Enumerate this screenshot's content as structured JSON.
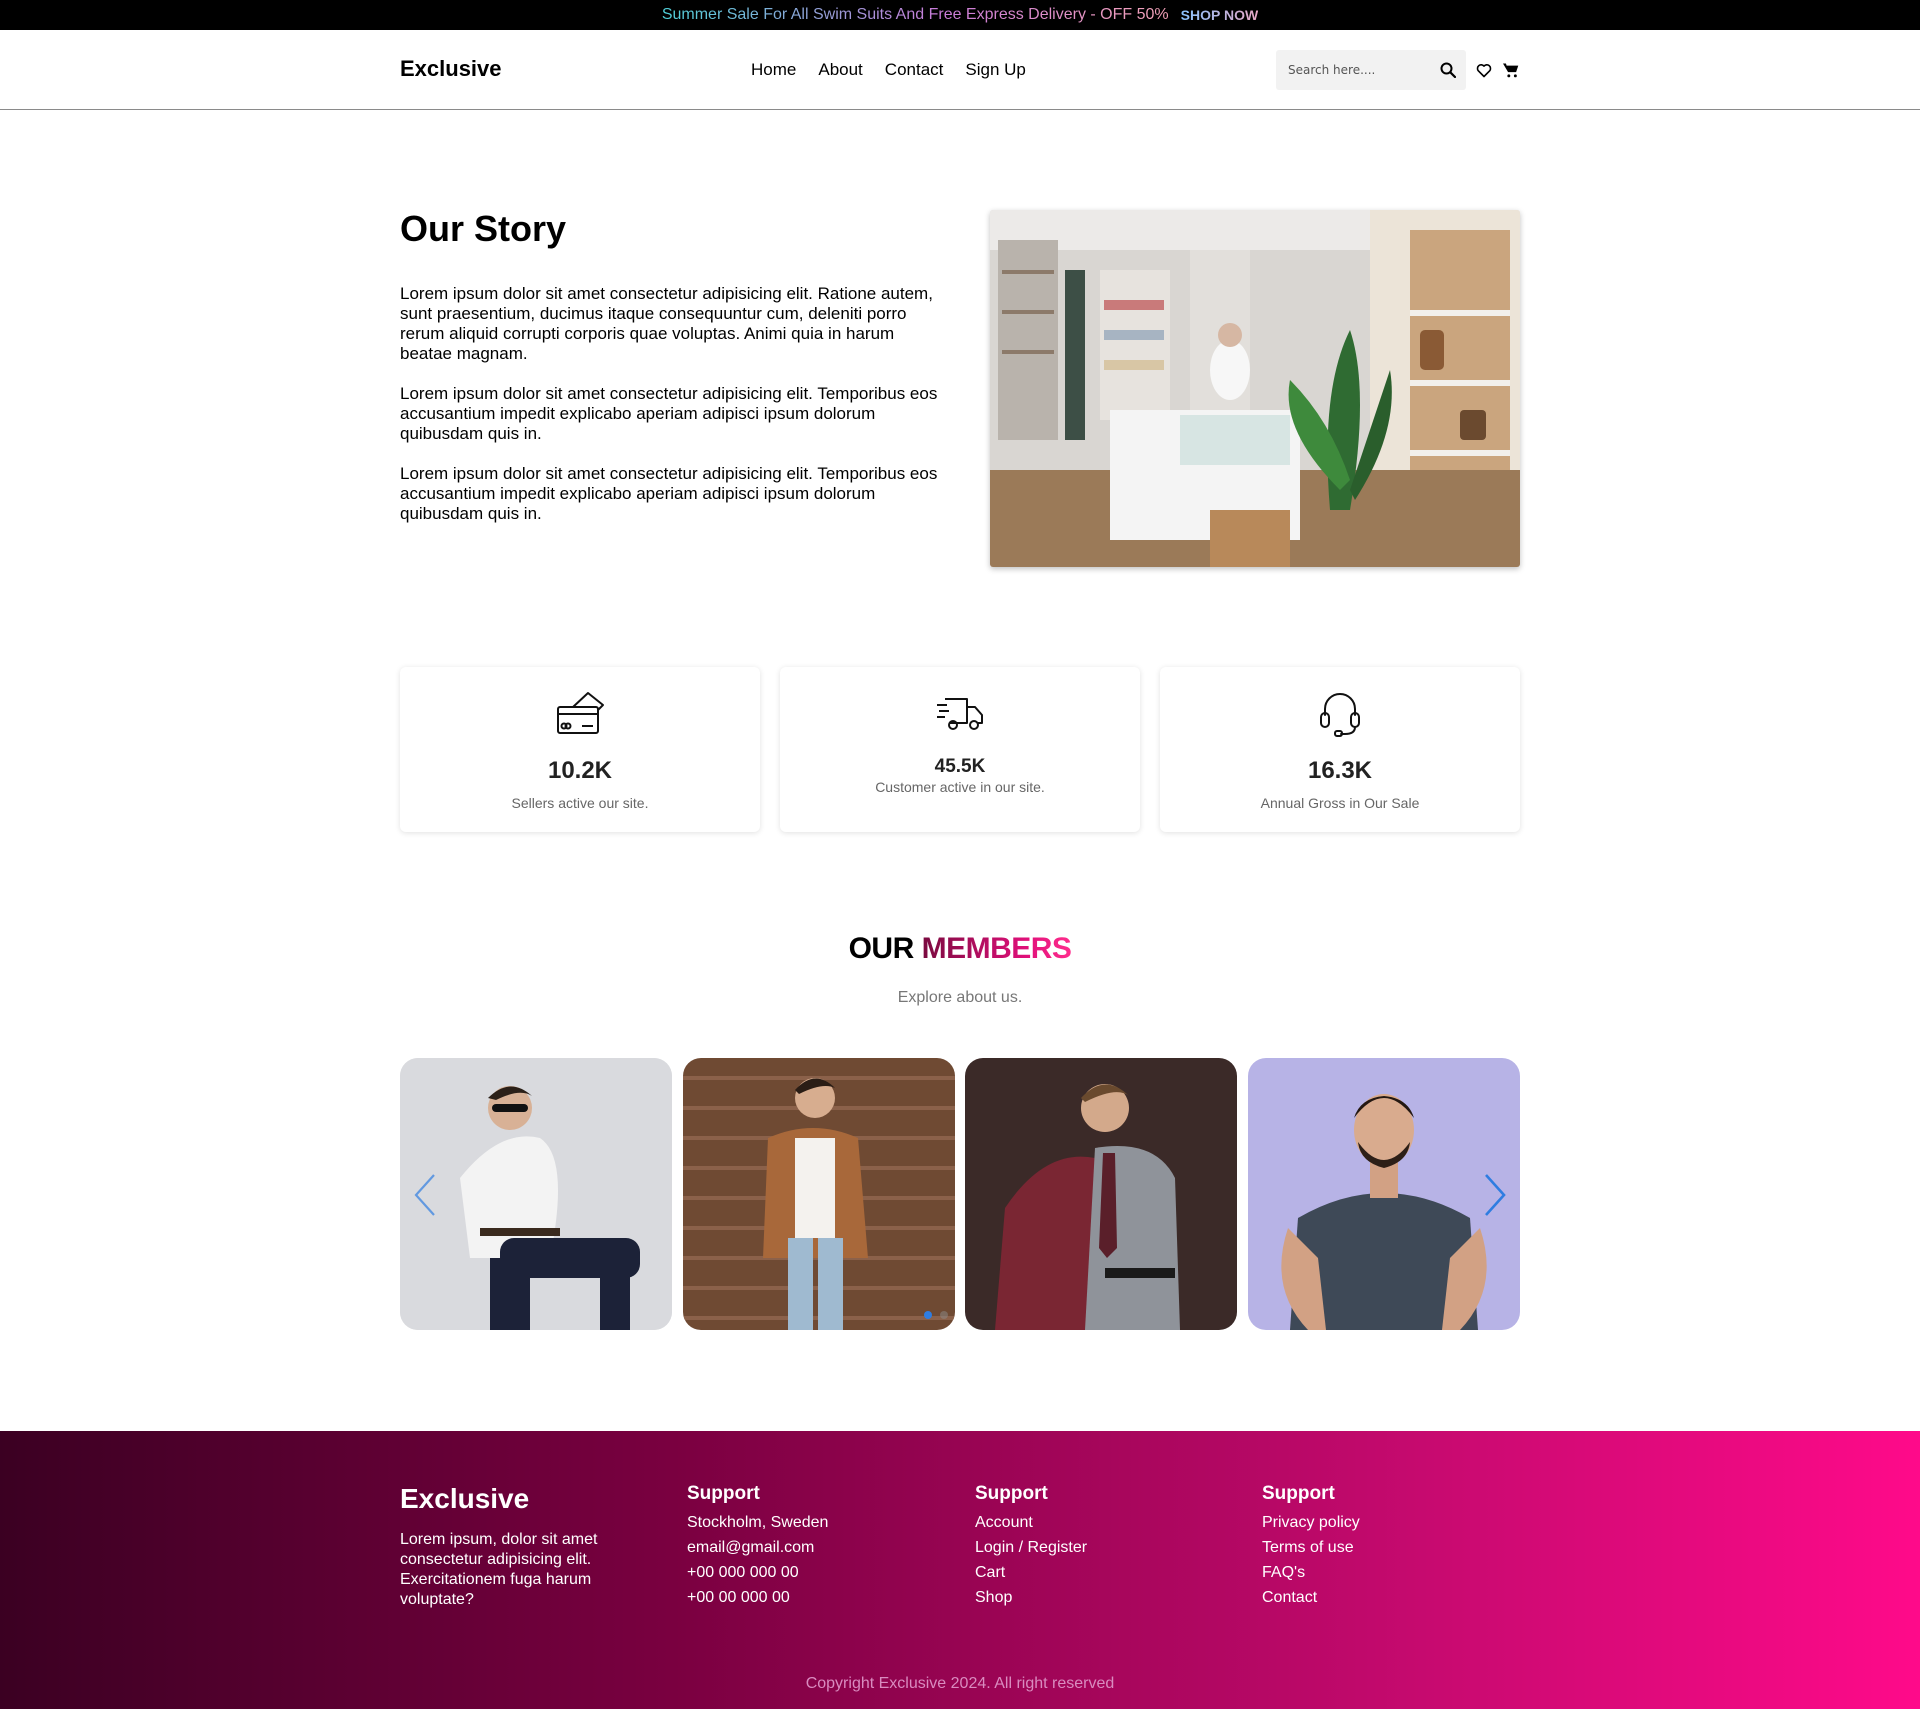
{
  "promo": {
    "text": "Summer Sale For All Swim Suits And Free Express Delivery - OFF 50%",
    "link": "SHOP NOW"
  },
  "header": {
    "logo": "Exclusive",
    "nav": [
      "Home",
      "About",
      "Contact",
      "Sign Up"
    ],
    "search_placeholder": "Search here...."
  },
  "story": {
    "title": "Our Story",
    "paragraphs": [
      "Lorem ipsum dolor sit amet consectetur adipisicing elit. Ratione autem, sunt praesentium, ducimus itaque consequuntur cum, deleniti porro rerum aliquid corrupti corporis quae voluptas. Animi quia in harum beatae magnam.",
      "Lorem ipsum dolor sit amet consectetur adipisicing elit. Temporibus eos accusantium impedit explicabo aperiam adipisci ipsum dolorum quibusdam quis in.",
      "Lorem ipsum dolor sit amet consectetur adipisicing elit. Temporibus eos accusantium impedit explicabo aperiam adipisci ipsum dolorum quibusdam quis in."
    ]
  },
  "stats": [
    {
      "icon": "credit-card-icon",
      "value": "10.2K",
      "label": "Sellers active our site."
    },
    {
      "icon": "delivery-truck-icon",
      "value": "45.5K",
      "label": "Customer active in our site."
    },
    {
      "icon": "headset-icon",
      "value": "16.3K",
      "label": "Annual Gross in Our Sale"
    }
  ],
  "members": {
    "title_plain": "OUR",
    "title_accent": "MEMBERS",
    "subtitle": "Explore about us.",
    "active_slide": 1,
    "slide_count": 2
  },
  "footer": {
    "logo": "Exclusive",
    "description": "Lorem ipsum, dolor sit amet consectetur adipisicing elit. Exercitationem fuga harum voluptate?",
    "columns": [
      {
        "title": "Support",
        "items": [
          "Stockholm, Sweden",
          "email@gmail.com",
          "+00 000 000 00",
          "+00 00 000 00"
        ]
      },
      {
        "title": "Support",
        "items": [
          "Account",
          "Login / Register",
          "Cart",
          "Shop"
        ]
      },
      {
        "title": "Support",
        "items": [
          "Privacy policy",
          "Terms of use",
          "FAQ's",
          "Contact"
        ]
      }
    ],
    "copyright": "Copyright Exclusive 2024. All right reserved"
  },
  "colors": {
    "accent": "#e0107a",
    "footer_start": "#3b0022",
    "footer_end": "#ff0a8a",
    "carousel_arrow": "#2f7de1"
  }
}
